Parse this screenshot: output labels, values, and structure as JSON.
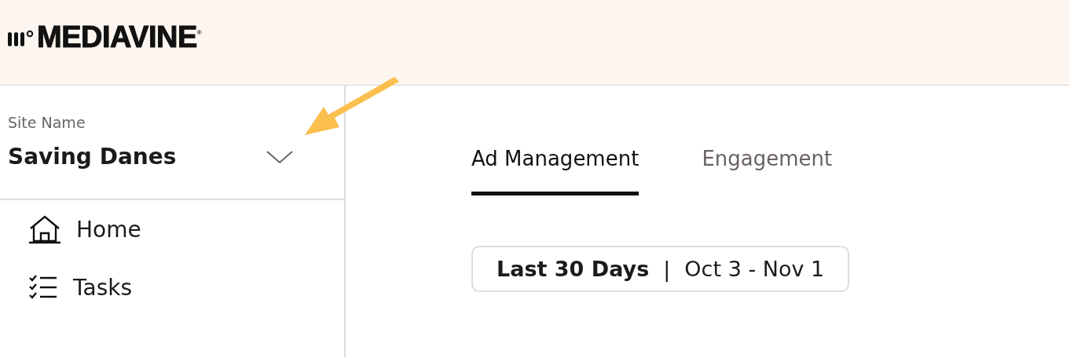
{
  "header": {
    "logo": "MEDIAVINE$^{®}$"
  },
  "sidebar": {
    "site_label": "Site Name",
    "site_name": "Saving Danes",
    "items": [
      {
        "label": "Home",
        "kind": "home"
      },
      {
        "label": "Tasks",
        "kind": "tasks"
      }
    ]
  },
  "tabs": [
    {
      "label": "Ad Management",
      "selected": true
    },
    {
      "label": "Engagement",
      "selected": false
    }
  ],
  "date_range": {
    "preset": "Last 30 Days",
    "separator": "|",
    "range": "Oct 3 - Nov 1"
  }
}
